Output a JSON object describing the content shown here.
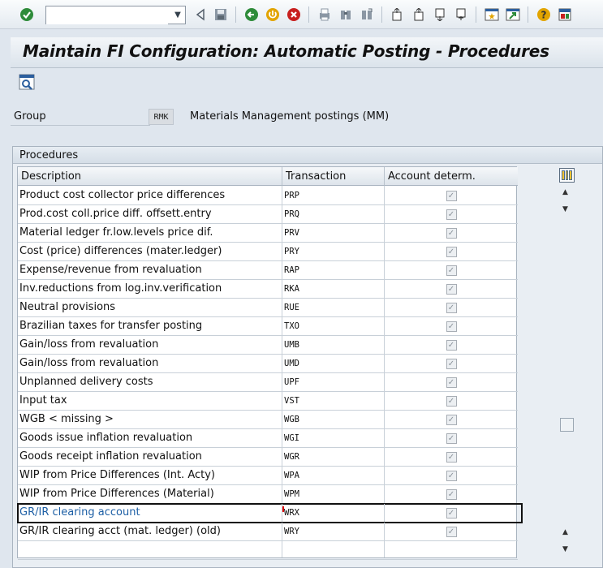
{
  "toolbar": {
    "command_value": "",
    "icons": [
      "enter-icon",
      "back-icon",
      "exit-icon",
      "cancel-icon",
      "print-icon",
      "find-icon",
      "find-next-icon",
      "first-page-icon",
      "previous-page-icon",
      "next-page-icon",
      "last-page-icon",
      "create-session-icon",
      "shortcut-icon",
      "help-icon",
      "customize-layout-icon"
    ]
  },
  "title": "Maintain FI Configuration: Automatic Posting - Procedures",
  "group": {
    "label": "Group",
    "value": "RMK",
    "description": "Materials Management postings (MM)"
  },
  "procedures": {
    "frame_title": "Procedures",
    "columns": [
      "Description",
      "Transaction",
      "Account determ."
    ],
    "rows": [
      {
        "description": "Product cost collector price differences",
        "transaction": "PRP",
        "account_determ": true
      },
      {
        "description": "Prod.cost coll.price diff. offsett.entry",
        "transaction": "PRQ",
        "account_determ": true
      },
      {
        "description": "Material ledger fr.low.levels price dif.",
        "transaction": "PRV",
        "account_determ": true
      },
      {
        "description": "Cost (price) differences (mater.ledger)",
        "transaction": "PRY",
        "account_determ": true
      },
      {
        "description": "Expense/revenue from revaluation",
        "transaction": "RAP",
        "account_determ": true
      },
      {
        "description": "Inv.reductions from log.inv.verification",
        "transaction": "RKA",
        "account_determ": true
      },
      {
        "description": "Neutral provisions",
        "transaction": "RUE",
        "account_determ": true
      },
      {
        "description": "Brazilian taxes for transfer posting",
        "transaction": "TXO",
        "account_determ": true
      },
      {
        "description": "Gain/loss from revaluation",
        "transaction": "UMB",
        "account_determ": true
      },
      {
        "description": "Gain/loss from revaluation",
        "transaction": "UMD",
        "account_determ": true
      },
      {
        "description": "Unplanned delivery costs",
        "transaction": "UPF",
        "account_determ": true
      },
      {
        "description": "Input tax",
        "transaction": "VST",
        "account_determ": true
      },
      {
        "description": "WGB < missing >",
        "transaction": "WGB",
        "account_determ": true
      },
      {
        "description": "Goods issue inflation revaluation",
        "transaction": "WGI",
        "account_determ": true
      },
      {
        "description": "Goods receipt inflation revaluation",
        "transaction": "WGR",
        "account_determ": true
      },
      {
        "description": "WIP from Price Differences (Int. Acty)",
        "transaction": "WPA",
        "account_determ": true
      },
      {
        "description": "WIP from Price Differences (Material)",
        "transaction": "WPM",
        "account_determ": true
      },
      {
        "description": "GR/IR clearing account",
        "transaction": "WRX",
        "account_determ": true,
        "selected": true
      },
      {
        "description": "GR/IR clearing acct (mat. ledger) (old)",
        "transaction": "WRY",
        "account_determ": true
      }
    ]
  },
  "colors": {
    "background": "#dfe6ee",
    "selected_text": "#1d5fa5",
    "grid_border": "#a9b4c0"
  }
}
